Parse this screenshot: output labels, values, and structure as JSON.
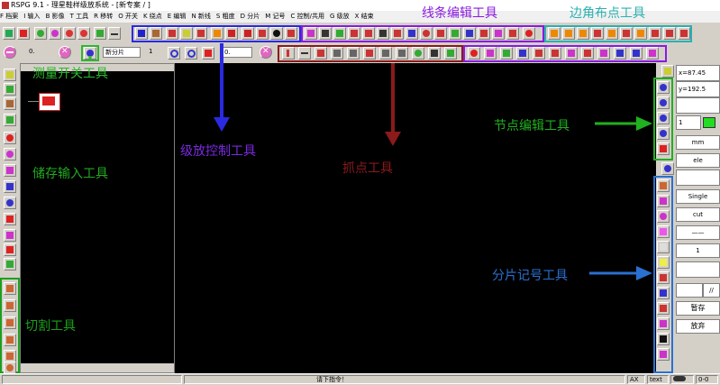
{
  "window": {
    "title": "RSPG 9.1 - 理星鞋样级放系统 - [新专案 / ]"
  },
  "menu": [
    "F 档案",
    "I 输入",
    "B 影像",
    "T 工具",
    "R 移转",
    "O 开关",
    "K 绕点",
    "E 编辑",
    "N 新线",
    "S 粗度",
    "D 分片",
    "M 记号",
    "C 控制/共用",
    "G 级放",
    "X 结束"
  ],
  "toolbar2": {
    "value1": "0.",
    "piece_select": "新分片",
    "value2": "1",
    "value3": "0."
  },
  "annotations": {
    "line_edit": "线条编辑工具",
    "corner_layout": "边角布点工具",
    "measure_switch": "测量开关工具",
    "grade_control": "级放控制工具",
    "snap_point": "抓点工具",
    "node_edit": "节点编辑工具",
    "store_input": "储存输入工具",
    "piece_mark": "分片记号工具",
    "cut": "切割工具"
  },
  "annotation_colors": {
    "line_edit": "#8a1ae0",
    "corner_layout": "#2ab0b0",
    "measure_switch": "#2cb82c",
    "grade_control": "#7a2ae0",
    "snap_point": "#8b1a1a",
    "node_edit": "#20b020",
    "store_input": "#22aa22",
    "piece_mark": "#2a70d0",
    "cut": "#1ca01c"
  },
  "right_panel": {
    "x": "x=87.45",
    "y": "y=192.5",
    "layer": "1",
    "unit": "mm",
    "ele": "ele",
    "single": "Single",
    "cut": "cut",
    "dash": "——",
    "count": "1",
    "slash": "//",
    "save_temp": "暂存",
    "discard": "放弃"
  },
  "status": {
    "prompt": "请下指令！",
    "ax": "AX",
    "text": "text",
    "coord": "0-0"
  }
}
